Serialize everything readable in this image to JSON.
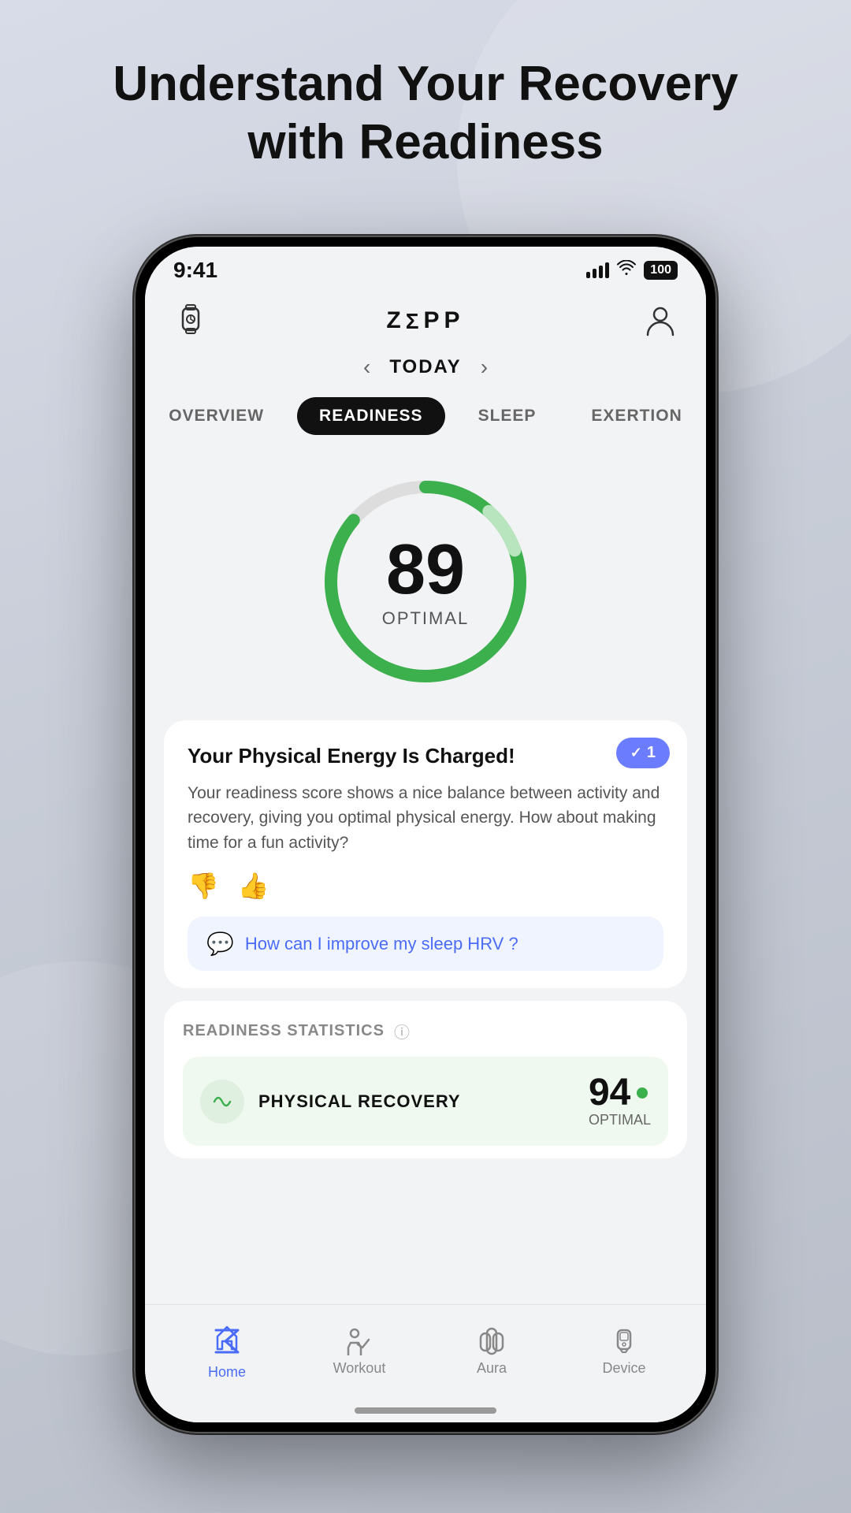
{
  "headline": {
    "line1": "Understand Your Recovery",
    "line2": "with Readiness"
  },
  "status_bar": {
    "time": "9:41",
    "battery": "100"
  },
  "header": {
    "logo": "ZEPP"
  },
  "date_nav": {
    "label": "TODAY"
  },
  "tabs": [
    {
      "id": "overview",
      "label": "OVERVIEW",
      "active": false
    },
    {
      "id": "readiness",
      "label": "READINESS",
      "active": true
    },
    {
      "id": "sleep",
      "label": "SLEEP",
      "active": false
    },
    {
      "id": "exertion",
      "label": "EXERTION",
      "active": false
    }
  ],
  "score": {
    "value": "89",
    "label": "OPTIMAL"
  },
  "energy_card": {
    "badge_count": "1",
    "title": "Your Physical Energy Is Charged!",
    "description": "Your readiness score shows a nice balance between activity and recovery, giving you optimal physical energy. How about making time for a fun activity?",
    "ai_question": "How can I improve my sleep HRV ?"
  },
  "stats": {
    "section_title": "READINESS STATISTICS",
    "items": [
      {
        "name": "PHYSICAL RECOVERY",
        "value": "94",
        "sublabel": "OPTIMAL",
        "status_color": "#3db04e"
      }
    ]
  },
  "bottom_nav": [
    {
      "id": "home",
      "label": "Home",
      "active": true
    },
    {
      "id": "workout",
      "label": "Workout",
      "active": false
    },
    {
      "id": "aura",
      "label": "Aura",
      "active": false
    },
    {
      "id": "device",
      "label": "Device",
      "active": false
    }
  ]
}
